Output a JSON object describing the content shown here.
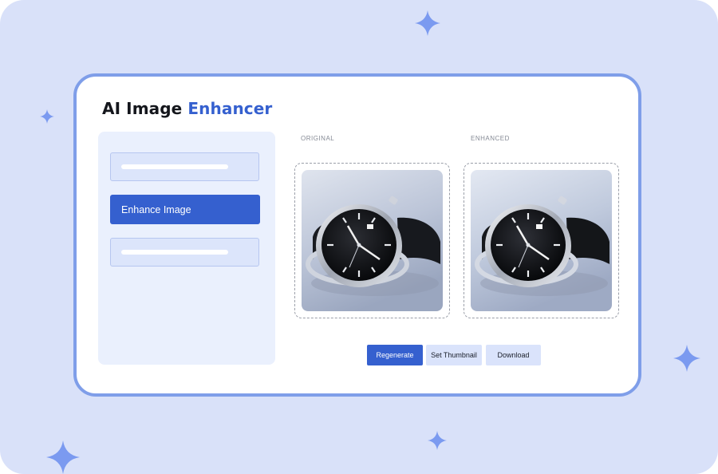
{
  "app": {
    "title_plain": "AI Image",
    "title_accent": "Enhancer"
  },
  "sidebar": {
    "primary_button_label": "Enhance Image"
  },
  "preview": {
    "original_label": "ORIGINAL",
    "enhanced_label": "ENHANCED",
    "subject_icon": "wristwatch-photo"
  },
  "actions": {
    "regenerate_label": "Regenerate",
    "thumbnail_label": "Set Thumbnail",
    "download_label": "Download"
  },
  "colors": {
    "accent": "#3560cf",
    "background": "#d9e1f9",
    "card_border": "#7f9ee9",
    "sparkle": "#7b9af0"
  }
}
